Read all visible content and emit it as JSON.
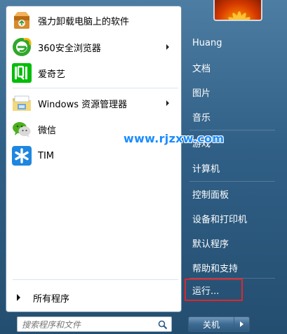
{
  "pinned_programs": [
    {
      "label": "强力卸载电脑上的软件",
      "icon": "uninstaller-icon",
      "submenu": false
    },
    {
      "label": "360安全浏览器",
      "icon": "360-browser-icon",
      "submenu": true
    },
    {
      "label": "爱奇艺",
      "icon": "iqiyi-icon",
      "submenu": false
    }
  ],
  "recent_programs": [
    {
      "label": "Windows 资源管理器",
      "icon": "explorer-folder-icon",
      "submenu": true
    },
    {
      "label": "微信",
      "icon": "wechat-icon",
      "submenu": false
    },
    {
      "label": "TIM",
      "icon": "tim-icon",
      "submenu": false
    }
  ],
  "all_programs_label": "所有程序",
  "search": {
    "placeholder": "搜索程序和文件"
  },
  "right_menu": [
    "Huang",
    "文档",
    "图片",
    "音乐",
    "游戏",
    "计算机",
    "控制面板",
    "设备和打印机",
    "默认程序",
    "帮助和支持",
    "运行..."
  ],
  "shutdown_label": "关机",
  "watermark": "www.rjzxw.com",
  "colors": {
    "highlight_box": "#e0262b",
    "watermark": "#1a8cff"
  }
}
